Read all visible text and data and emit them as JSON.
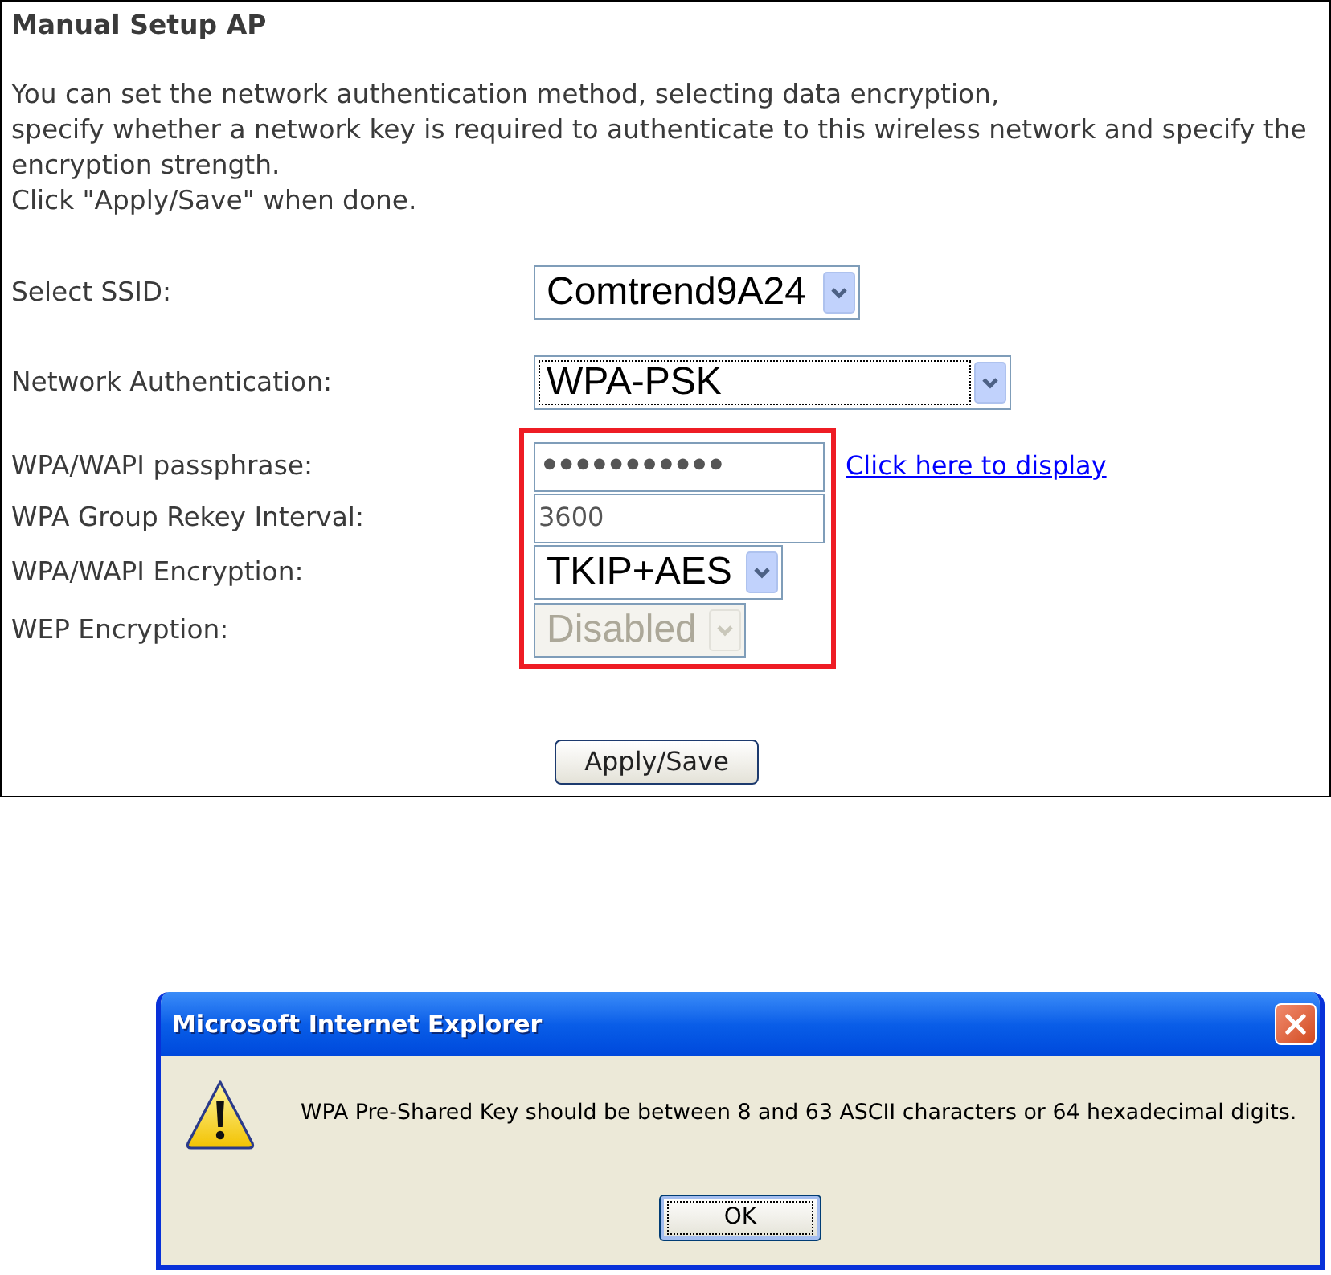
{
  "panel": {
    "title": "Manual Setup AP",
    "description_lines": [
      "You can set the network authentication method, selecting data encryption,",
      "specify whether a network key is required to authenticate to this wireless network and specify the",
      "encryption strength.",
      "Click \"Apply/Save\" when done."
    ]
  },
  "fields": [
    {
      "kind": "select",
      "label": "Select SSID:",
      "value": "Comtrend9A24",
      "disabled": false,
      "focused": false,
      "highlighted": false
    },
    {
      "kind": "select",
      "label": "Network Authentication:",
      "value": "WPA-PSK",
      "disabled": false,
      "focused": true,
      "highlighted": false
    },
    {
      "kind": "password",
      "label": "WPA/WAPI passphrase:",
      "value": "●●●●●●●●●●●",
      "link": "Click here to display",
      "disabled": false,
      "focused": false,
      "highlighted": true
    },
    {
      "kind": "text",
      "label": "WPA Group Rekey Interval:",
      "value": "3600",
      "disabled": false,
      "focused": false,
      "highlighted": true
    },
    {
      "kind": "select",
      "label": "WPA/WAPI Encryption:",
      "value": "TKIP+AES",
      "disabled": false,
      "focused": false,
      "highlighted": true
    },
    {
      "kind": "select",
      "label": "WEP Encryption:",
      "value": "Disabled",
      "disabled": true,
      "focused": false,
      "highlighted": true
    }
  ],
  "apply_button": "Apply/Save",
  "dialog": {
    "title": "Microsoft Internet Explorer",
    "message": "WPA Pre-Shared Key should be between 8 and 63 ASCII characters or 64 hexadecimal digits.",
    "buttons": [
      "OK"
    ]
  }
}
